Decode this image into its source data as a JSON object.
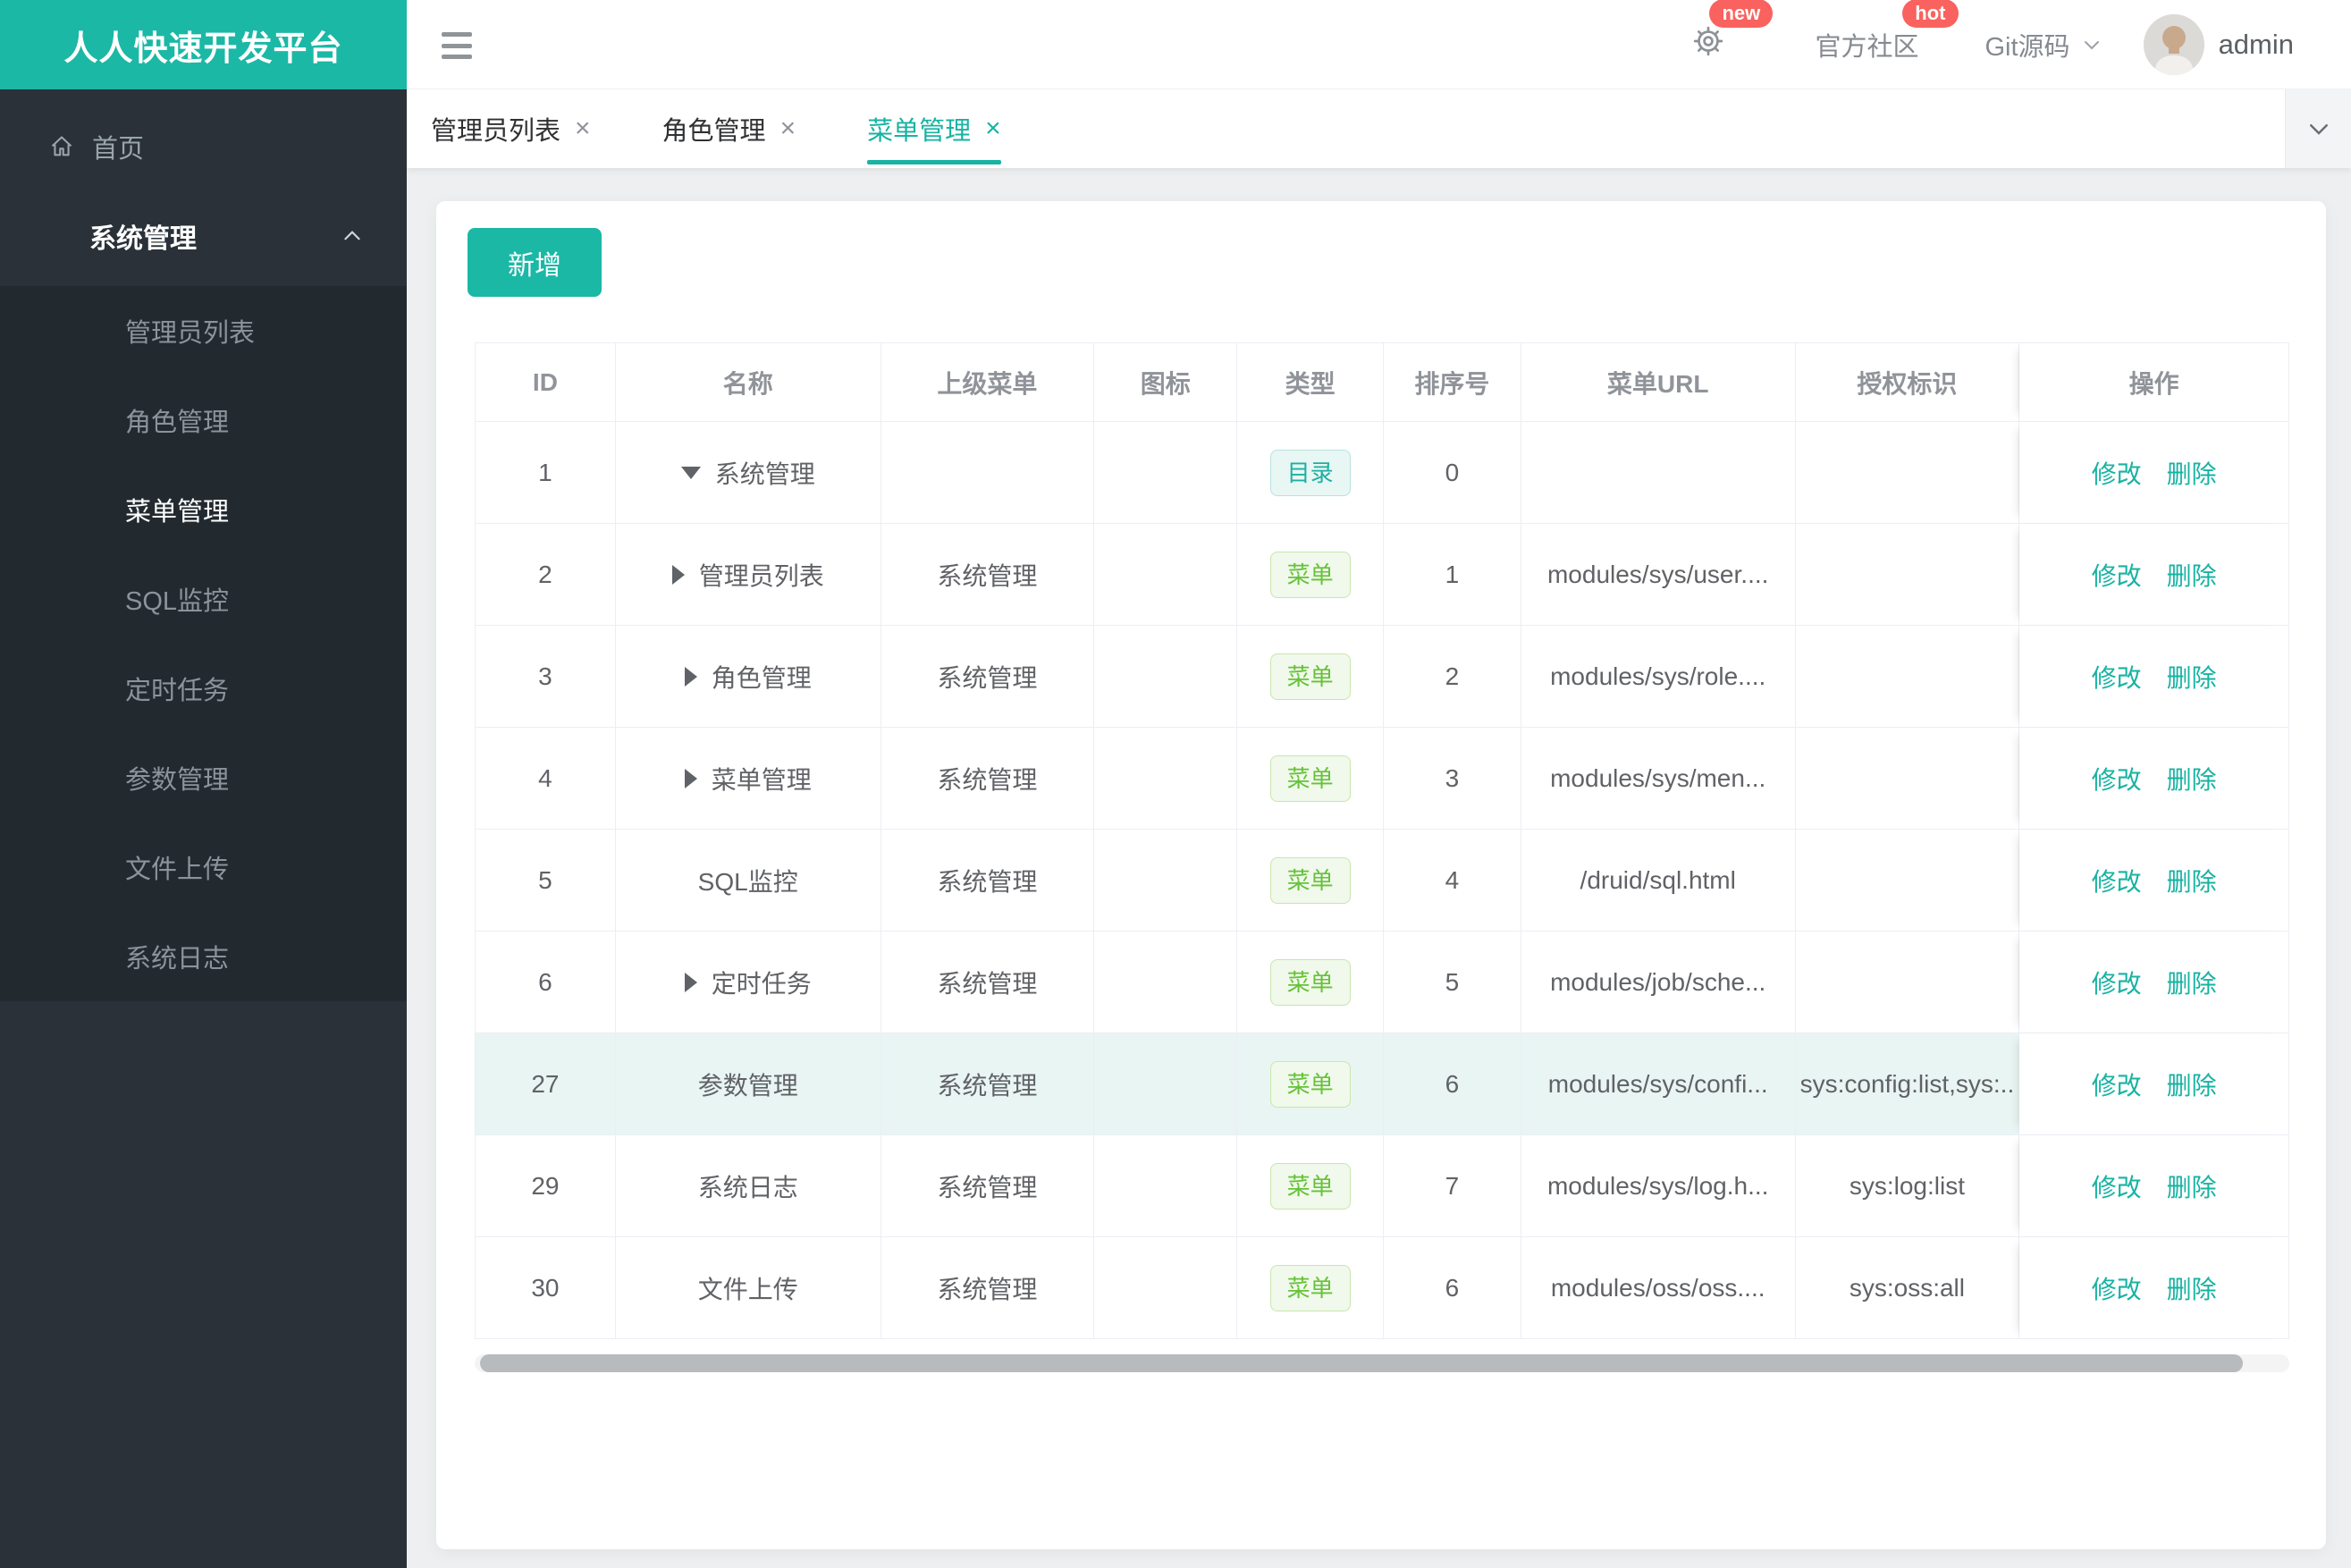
{
  "brand": {
    "title": "人人快速开发平台"
  },
  "header": {
    "badge_new": "new",
    "badge_hot": "hot",
    "community_label": "官方社区",
    "git_label": "Git源码",
    "user_name": "admin"
  },
  "tabs": [
    {
      "label": "管理员列表",
      "active": false
    },
    {
      "label": "角色管理",
      "active": false
    },
    {
      "label": "菜单管理",
      "active": true
    }
  ],
  "sidebar": {
    "home_label": "首页",
    "group_label": "系统管理",
    "items": [
      {
        "label": "管理员列表",
        "active": false
      },
      {
        "label": "角色管理",
        "active": false
      },
      {
        "label": "菜单管理",
        "active": true
      },
      {
        "label": "SQL监控",
        "active": false
      },
      {
        "label": "定时任务",
        "active": false
      },
      {
        "label": "参数管理",
        "active": false
      },
      {
        "label": "文件上传",
        "active": false
      },
      {
        "label": "系统日志",
        "active": false
      }
    ]
  },
  "toolbar": {
    "add_label": "新增"
  },
  "table": {
    "headers": [
      "ID",
      "名称",
      "上级菜单",
      "图标",
      "类型",
      "排序号",
      "菜单URL",
      "授权标识",
      "操作"
    ],
    "type_labels": {
      "dir": "目录",
      "menu": "菜单"
    },
    "actions": {
      "edit": "修改",
      "delete": "删除"
    },
    "rows": [
      {
        "id": "1",
        "arrow": "down",
        "name": "系统管理",
        "parent": "",
        "type": "dir",
        "sort": "0",
        "url": "",
        "auth": "",
        "highlight": false
      },
      {
        "id": "2",
        "arrow": "right",
        "name": "管理员列表",
        "parent": "系统管理",
        "type": "menu",
        "sort": "1",
        "url": "modules/sys/user....",
        "auth": "",
        "highlight": false
      },
      {
        "id": "3",
        "arrow": "right",
        "name": "角色管理",
        "parent": "系统管理",
        "type": "menu",
        "sort": "2",
        "url": "modules/sys/role....",
        "auth": "",
        "highlight": false
      },
      {
        "id": "4",
        "arrow": "right",
        "name": "菜单管理",
        "parent": "系统管理",
        "type": "menu",
        "sort": "3",
        "url": "modules/sys/men...",
        "auth": "",
        "highlight": false
      },
      {
        "id": "5",
        "arrow": "none",
        "name": "SQL监控",
        "parent": "系统管理",
        "type": "menu",
        "sort": "4",
        "url": "/druid/sql.html",
        "auth": "",
        "highlight": false
      },
      {
        "id": "6",
        "arrow": "right",
        "name": "定时任务",
        "parent": "系统管理",
        "type": "menu",
        "sort": "5",
        "url": "modules/job/sche...",
        "auth": "",
        "highlight": false
      },
      {
        "id": "27",
        "arrow": "none",
        "name": "参数管理",
        "parent": "系统管理",
        "type": "menu",
        "sort": "6",
        "url": "modules/sys/confi...",
        "auth": "sys:config:list,sys:..",
        "highlight": true
      },
      {
        "id": "29",
        "arrow": "none",
        "name": "系统日志",
        "parent": "系统管理",
        "type": "menu",
        "sort": "7",
        "url": "modules/sys/log.h...",
        "auth": "sys:log:list",
        "highlight": false
      },
      {
        "id": "30",
        "arrow": "none",
        "name": "文件上传",
        "parent": "系统管理",
        "type": "menu",
        "sort": "6",
        "url": "modules/oss/oss....",
        "auth": "sys:oss:all",
        "highlight": false
      }
    ]
  },
  "colors": {
    "accent": "#17b3a3",
    "brand_bg": "#1bb8a6",
    "badge_red": "#f9625e",
    "tag_menu_green": "#67c23a",
    "tag_dir_teal": "#1db0a1",
    "sidebar_bg": "#2a3138",
    "highlight_row": "#e9f5f2"
  }
}
